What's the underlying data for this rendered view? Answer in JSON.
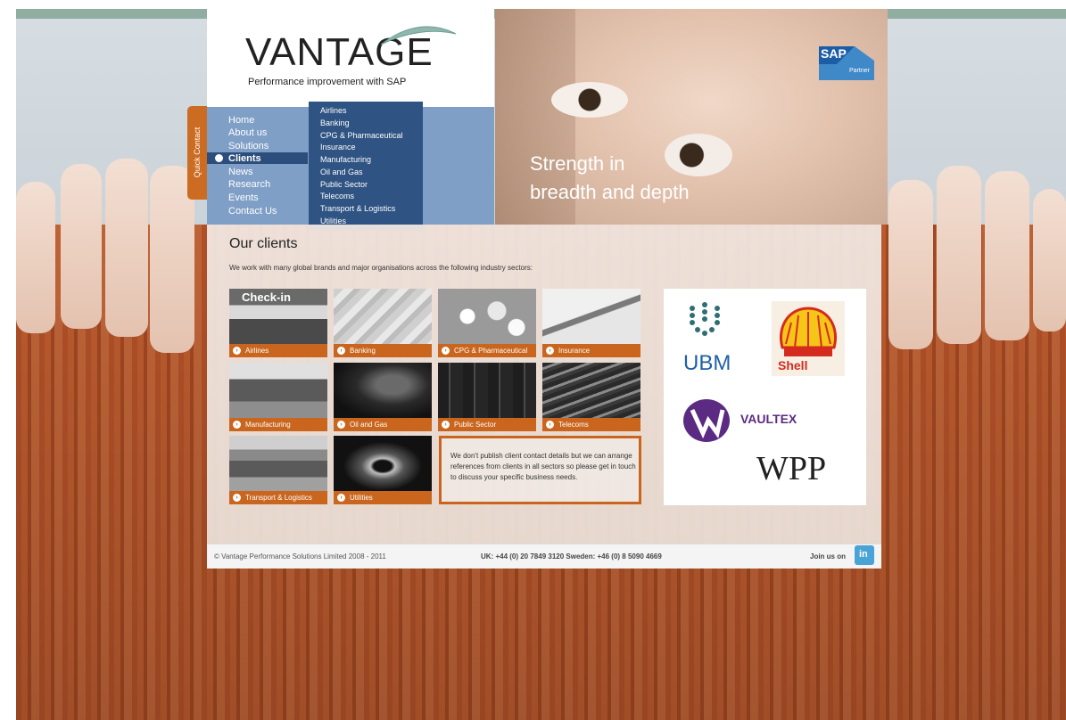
{
  "header": {
    "logo_wordmark": "VANTAGE",
    "logo_tagline": "Performance improvement with SAP",
    "sap_badge_text": "SAP",
    "sap_partner_text": "Partner"
  },
  "quick_contact": "Quick Contact",
  "nav": {
    "items": [
      {
        "label": "Home"
      },
      {
        "label": "About us"
      },
      {
        "label": "Solutions"
      },
      {
        "label": "Clients"
      },
      {
        "label": "News"
      },
      {
        "label": "Research"
      },
      {
        "label": "Events"
      },
      {
        "label": "Contact Us"
      }
    ],
    "active": "Clients"
  },
  "dropdown": {
    "items": [
      "Airlines",
      "Banking",
      "CPG & Pharmaceutical",
      "Insurance",
      "Manufacturing",
      "Oil and Gas",
      "Public Sector",
      "Telecoms",
      "Transport & Logistics",
      "Utilities"
    ]
  },
  "hero": {
    "line1": "Strength in",
    "line2": "breadth and depth"
  },
  "content": {
    "title": "Our clients",
    "intro": "We work with many global brands and major organisations across the following industry sectors:",
    "tiles": [
      {
        "label": "Airlines",
        "image_text": "Check-in"
      },
      {
        "label": "Banking"
      },
      {
        "label": "CPG & Pharmaceutical"
      },
      {
        "label": "Insurance"
      },
      {
        "label": "Manufacturing"
      },
      {
        "label": "Oil and Gas"
      },
      {
        "label": "Public Sector"
      },
      {
        "label": "Telecoms"
      },
      {
        "label": "Transport & Logistics"
      },
      {
        "label": "Utilities"
      }
    ],
    "notice": "We don't publish client contact details but we can arrange references from clients in all sectors so please get in touch to discuss your specific business needs.",
    "client_logos": [
      "UBM",
      "Shell",
      "VAULTEX",
      "WPP"
    ]
  },
  "footer": {
    "copyright": "© Vantage Performance Solutions Limited 2008 - 2011",
    "phone": "UK: +44 (0) 20 7849 3120   Sweden: +46 (0) 8 5090 4669",
    "join": "Join us on",
    "linkedin_text": "in"
  },
  "colors": {
    "accent_orange": "#c9651d",
    "nav_blue": "#7f9fc6",
    "dropdown_blue": "#2f5382",
    "top_bar": "#8fada0"
  }
}
